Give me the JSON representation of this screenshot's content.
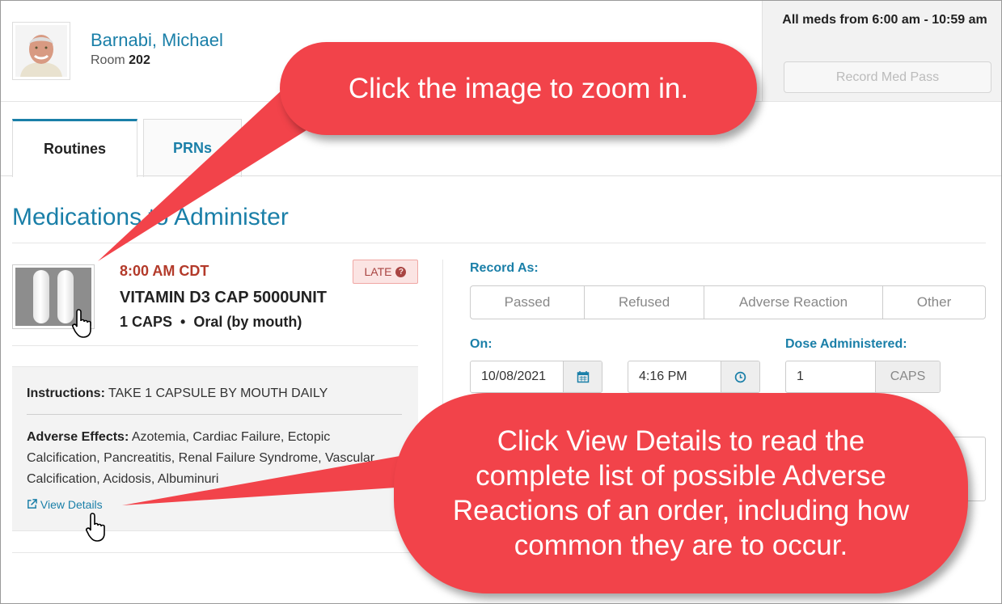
{
  "patient": {
    "name": "Barnabi, Michael",
    "room_label": "Room",
    "room_number": "202"
  },
  "header_right": {
    "allmeds_text": "All meds from 6:00 am - 10:59 am",
    "record_button": "Record Med Pass"
  },
  "tabs": [
    {
      "label": "Routines",
      "active": true
    },
    {
      "label": "PRNs",
      "active": false
    }
  ],
  "section_title": "Medications to Administer",
  "medication": {
    "time": "8:00 AM CDT",
    "status_badge": "LATE",
    "name": "VITAMIN D3 CAP 5000UNIT",
    "dose": "1 CAPS",
    "route": "Oral (by mouth)",
    "instructions_label": "Instructions:",
    "instructions": "TAKE 1 CAPSULE BY MOUTH DAILY",
    "adverse_label": "Adverse Effects:",
    "adverse_effects": "Azotemia, Cardiac Failure, Ectopic Calcification, Pancreatitis, Renal Failure Syndrome, Vascular Calcification, Acidosis, Albuminuri",
    "view_details": "View Details"
  },
  "record_form": {
    "record_as_label": "Record As:",
    "options": [
      "Passed",
      "Refused",
      "Adverse Reaction",
      "Other"
    ],
    "on_label": "On:",
    "date": "10/08/2021",
    "time": "4:16 PM",
    "dose_label": "Dose Administered:",
    "dose_value": "1",
    "dose_unit": "CAPS"
  },
  "callouts": {
    "zoom": "Click the image to zoom in.",
    "details": "Click View Details to read the complete list of possible Adverse Reactions of an order, including how common they are to occur."
  },
  "colors": {
    "accent": "#1a7fa8",
    "late": "#b33a2a",
    "callout": "#f2434a"
  }
}
